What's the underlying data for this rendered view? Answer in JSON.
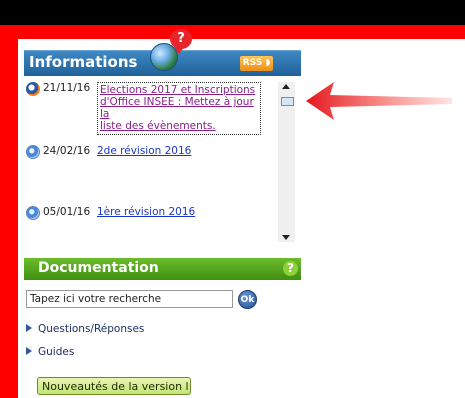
{
  "informations": {
    "title": "Informations",
    "bubble_glyph": "?",
    "rss_label": "RSS",
    "icons": [
      "globe-icon",
      "question-bubble-icon",
      "rss-icon"
    ]
  },
  "news": [
    {
      "date": "21/11/16",
      "title": "Elections 2017 et Inscriptions d'Office INSEE : Mettez à jour la liste des évènements.",
      "lines": [
        "Elections 2017 et Inscriptions",
        "d'Office INSEE : Mettez à jour la",
        "liste des évènements."
      ],
      "icon": "election-icon"
    },
    {
      "date": "24/02/16",
      "title": "2de révision 2016",
      "icon": "tools-icon"
    },
    {
      "date": "05/01/16",
      "title": "1ère révision 2016",
      "icon": "tools-icon"
    }
  ],
  "documentation": {
    "title": "Documentation",
    "help_glyph": "?",
    "search": {
      "value": "Tapez ici votre recherche",
      "ok_label": "Ok"
    },
    "links": [
      "Questions/Réponses",
      "Guides"
    ],
    "new_button": "Nouveautés de la version l"
  },
  "colors": {
    "frame": "#ff0000",
    "info_header": "#2e72b0",
    "doc_header": "#55a81f",
    "link": "#1a35c8",
    "visited_link": "#8a1d8e"
  }
}
